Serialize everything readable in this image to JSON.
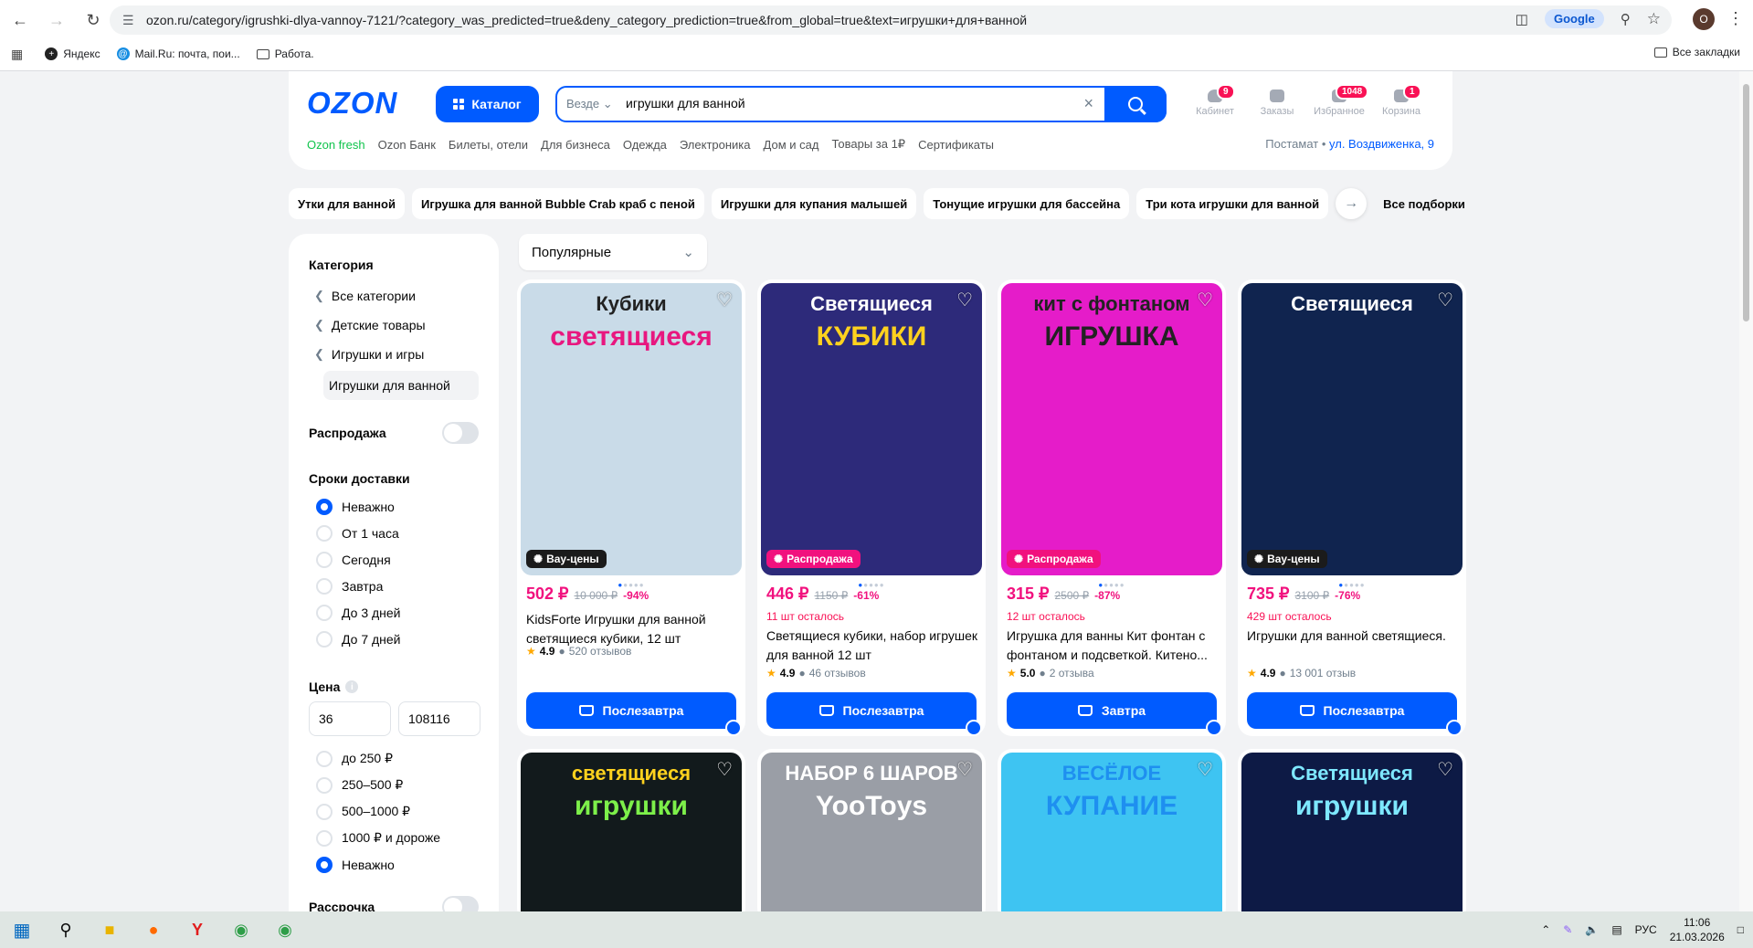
{
  "browser": {
    "url": "ozon.ru/category/igrushki-dlya-vannoy-7121/?category_was_predicted=true&deny_category_prediction=true&from_global=true&text=игрушки+для+ванной",
    "google_label": "Google",
    "profile_initial": "O",
    "bookmarks": [
      {
        "label": "Яндекс"
      },
      {
        "label": "Mail.Ru: почта, пои..."
      },
      {
        "label": "Работа."
      }
    ],
    "all_bookmarks": "Все закладки"
  },
  "header": {
    "logo": "OZON",
    "catalog_label": "Каталог",
    "search_scope": "Везде",
    "search_query": "игрушки для ванной",
    "icons": [
      {
        "label": "Кабинет",
        "badge": "9"
      },
      {
        "label": "Заказы",
        "badge": ""
      },
      {
        "label": "Избранное",
        "badge": "1048"
      },
      {
        "label": "Корзина",
        "badge": "1"
      }
    ],
    "subnav": [
      "Ozon fresh",
      "Ozon Банк",
      "Билеты, отели",
      "Для бизнеса",
      "Одежда",
      "Электроника",
      "Дом и сад",
      "Товары за 1₽",
      "Сертификаты"
    ],
    "address_prefix": "Постамат •",
    "address": "ул. Воздвиженка, 9"
  },
  "chips": [
    "Утки для ванной",
    "Игрушка для ванной Bubble Crab краб с пеной",
    "Игрушки для купания малышей",
    "Тонущие игрушки для бассейна",
    "Три кота игрушки для ванной"
  ],
  "all_selections": "Все подборки",
  "sidebar": {
    "category_title": "Категория",
    "categories": [
      "Все категории",
      "Детские товары",
      "Игрушки и игры"
    ],
    "current_category": "Игрушки для ванной",
    "sale_label": "Распродажа",
    "delivery_title": "Сроки доставки",
    "delivery_options": [
      "Неважно",
      "От 1 часа",
      "Сегодня",
      "Завтра",
      "До 3 дней",
      "До 7 дней"
    ],
    "price_title": "Цена",
    "price_min": "36",
    "price_max": "108116",
    "price_options": [
      "до 250 ₽",
      "250–500 ₽",
      "500–1000 ₽",
      "1000 ₽ и дороже",
      "Неважно"
    ],
    "installment_label": "Рассрочка"
  },
  "sort_label": "Популярные",
  "products": [
    {
      "img_title1": "Кубики",
      "img_title2": "светящиеся",
      "img_text1_color": "#222",
      "img_text2_color": "#e8177f",
      "img_bg": "#c9dbe8",
      "promo": "Вау-цены",
      "promo_color": "#1b1b1b",
      "price": "502 ₽",
      "old": "10 000 ₽",
      "pct": "-94%",
      "left": "",
      "name": "KidsForte Игрушки для ванной светящиеся кубики, 12 шт",
      "rating": "4.9",
      "reviews": "520 отзывов",
      "button": "Послезавтра"
    },
    {
      "img_title1": "Светящиеся",
      "img_title2": "КУБИКИ",
      "img_text1_color": "#fff",
      "img_text2_color": "#ffd21e",
      "img_bg": "#2d2a7a",
      "promo": "Распродажа",
      "promo_color": "#f1117e",
      "price": "446 ₽",
      "old": "1150 ₽",
      "pct": "-61%",
      "left": "11 шт осталось",
      "name": "Светящиеся кубики, набор игрушек для ванной 12 шт",
      "rating": "4.9",
      "reviews": "46 отзывов",
      "button": "Послезавтра"
    },
    {
      "img_title1": "кит с фонтаном",
      "img_title2": "ИГРУШКА",
      "img_text1_color": "#222",
      "img_text2_color": "#222",
      "img_bg": "#e51cc9",
      "promo": "Распродажа",
      "promo_color": "#f1117e",
      "price": "315 ₽",
      "old": "2500 ₽",
      "pct": "-87%",
      "left": "12 шт осталось",
      "name": "Игрушка для ванны Кит фонтан с фонтаном и подсветкой. Китено...",
      "rating": "5.0",
      "reviews": "2 отзыва",
      "button": "Завтра"
    },
    {
      "img_title1": "Светящиеся",
      "img_title2": "",
      "img_text1_color": "#fff",
      "img_text2_color": "#ffd21e",
      "img_bg": "#10244f",
      "promo": "Вау-цены",
      "promo_color": "#1b1b1b",
      "price": "735 ₽",
      "old": "3100 ₽",
      "pct": "-76%",
      "left": "429 шт осталось",
      "name": "Игрушки для ванной светящиеся.",
      "rating": "4.9",
      "reviews": "13 001 отзыв",
      "button": "Послезавтра"
    }
  ],
  "products_row2": [
    {
      "img_title1": "светящиеся",
      "img_title2": "игрушки",
      "img_text1_color": "#ffd21e",
      "img_text2_color": "#7df04a",
      "img_bg": "#121a1c"
    },
    {
      "img_title1": "НАБОР 6 ШАРОВ",
      "img_title2": "YooToys",
      "img_text1_color": "#fff",
      "img_text2_color": "#ffffff",
      "img_bg": "#9a9ea6"
    },
    {
      "img_title1": "ВЕСЁЛОЕ",
      "img_title2": "КУПАНИЕ",
      "img_text1_color": "#1e8ff0",
      "img_text2_color": "#1e8ff0",
      "img_bg": "#3ec4f2"
    },
    {
      "img_title1": "Светящиеся",
      "img_title2": "игрушки",
      "img_text1_color": "#7ee8ff",
      "img_text2_color": "#7ee8ff",
      "img_bg": "#0d1a45"
    }
  ],
  "taskbar": {
    "lang": "РУС",
    "time": "11:06",
    "date": "21.03.2026"
  }
}
